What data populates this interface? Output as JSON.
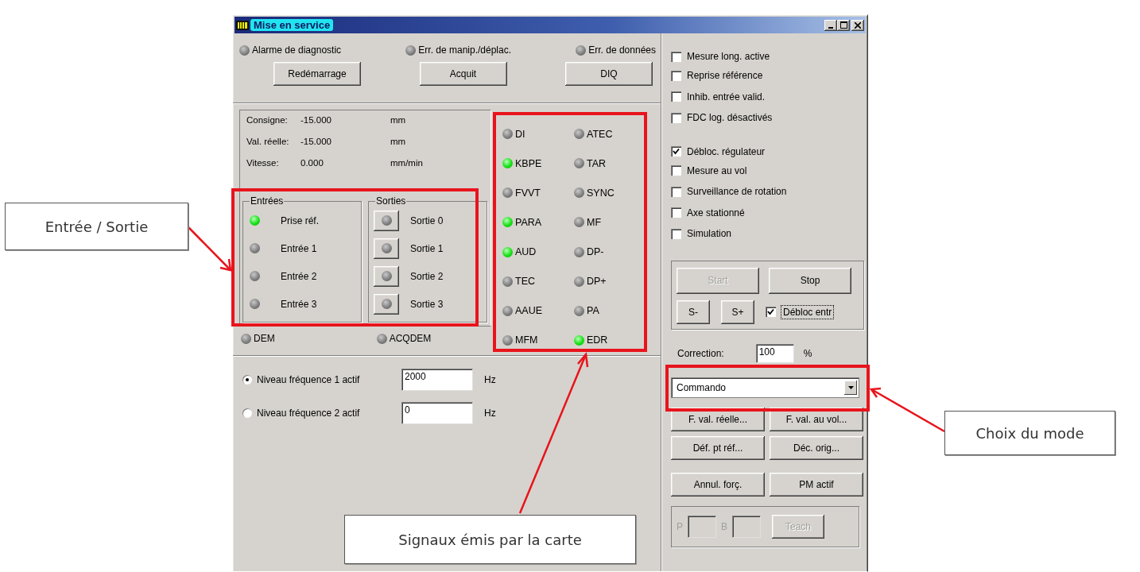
{
  "window": {
    "title": "Mise en service"
  },
  "alarms": [
    {
      "label": "Alarme de diagnostic",
      "on": false
    },
    {
      "label": "Err. de manip./déplac.",
      "on": false
    },
    {
      "label": "Err. de données",
      "on": false
    }
  ],
  "top_buttons": [
    "Redémarrage",
    "Acquit",
    "DIQ"
  ],
  "readouts": [
    {
      "label": "Consigne:",
      "value": "-15.000",
      "unit": "mm"
    },
    {
      "label": "Val. réelle:",
      "value": "-15.000",
      "unit": "mm"
    },
    {
      "label": "Vitesse:",
      "value": "0.000",
      "unit": "mm/min"
    }
  ],
  "inputs": {
    "title": "Entrées",
    "items": [
      {
        "label": "Prise réf.",
        "on": true
      },
      {
        "label": "Entrée 1",
        "on": false
      },
      {
        "label": "Entrée 2",
        "on": false
      },
      {
        "label": "Entrée 3",
        "on": false
      }
    ]
  },
  "outputs": {
    "title": "Sorties",
    "items": [
      {
        "label": "Sortie 0",
        "on": false
      },
      {
        "label": "Sortie 1",
        "on": false
      },
      {
        "label": "Sortie 2",
        "on": false
      },
      {
        "label": "Sortie 3",
        "on": false
      }
    ]
  },
  "status": [
    {
      "label": "DEM",
      "on": false
    },
    {
      "label": "ACQDEM",
      "on": false
    }
  ],
  "signals": [
    {
      "label": "DI",
      "on": false
    },
    {
      "label": "ATEC",
      "on": false
    },
    {
      "label": "KBPE",
      "on": true
    },
    {
      "label": "TAR",
      "on": false
    },
    {
      "label": "FVVT",
      "on": false
    },
    {
      "label": "SYNC",
      "on": false
    },
    {
      "label": "PARA",
      "on": true
    },
    {
      "label": "MF",
      "on": false
    },
    {
      "label": "AUD",
      "on": true
    },
    {
      "label": "DP-",
      "on": false
    },
    {
      "label": "TEC",
      "on": false
    },
    {
      "label": "DP+",
      "on": false
    },
    {
      "label": "AAUE",
      "on": false
    },
    {
      "label": "PA",
      "on": false
    },
    {
      "label": "MFM",
      "on": false
    },
    {
      "label": "EDR",
      "on": true
    }
  ],
  "frequencies": [
    {
      "label": "Niveau fréquence 1 actif",
      "selected": true,
      "value": "2000",
      "unit": "Hz"
    },
    {
      "label": "Niveau fréquence 2 actif",
      "selected": false,
      "value": "0",
      "unit": "Hz"
    }
  ],
  "option_groups": [
    [
      {
        "label": "Mesure long. active",
        "checked": false
      },
      {
        "label": "Reprise référence",
        "checked": false
      },
      {
        "label": "Inhib. entrée valid.",
        "checked": false
      },
      {
        "label": "FDC log. désactivés",
        "checked": false
      }
    ],
    [
      {
        "label": "Débloc. régulateur",
        "checked": true
      },
      {
        "label": "Mesure au vol",
        "checked": false
      },
      {
        "label": "Surveillance de rotation",
        "checked": false
      },
      {
        "label": "Axe stationné",
        "checked": false
      },
      {
        "label": "Simulation",
        "checked": false
      }
    ]
  ],
  "motion": {
    "start": {
      "label": "Start",
      "disabled": true
    },
    "stop": {
      "label": "Stop",
      "disabled": false
    },
    "jog_minus": "S-",
    "jog_plus": "S+",
    "enable": {
      "label": "Débloc entr",
      "checked": true
    }
  },
  "correction": {
    "label": "Correction:",
    "value": "100",
    "unit": "%"
  },
  "mode": {
    "value": "Commando"
  },
  "action_buttons": [
    "F. val. réelle...",
    "F. val. au vol...",
    "Déf. pt réf...",
    "Déc. orig...",
    "Annul. forç.",
    "PM actif"
  ],
  "teach": {
    "p_label": "P",
    "b_label": "B",
    "button": {
      "label": "Teach",
      "disabled": true
    }
  },
  "callouts": [
    {
      "text": "Entrée / Sortie"
    },
    {
      "text": "Signaux émis par la carte"
    },
    {
      "text": "Choix du mode"
    }
  ]
}
